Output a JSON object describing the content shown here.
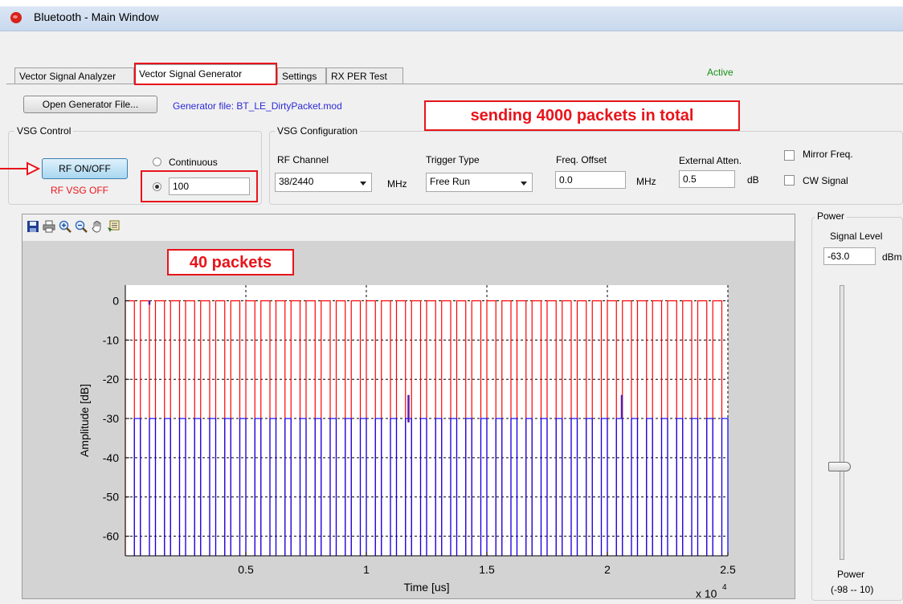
{
  "window": {
    "title": "Bluetooth - Main Window"
  },
  "tabs": [
    {
      "label": "Vector Signal Analyzer"
    },
    {
      "label": "Vector Signal Generator"
    },
    {
      "label": "Settings"
    },
    {
      "label": "RX PER Test"
    }
  ],
  "status": "Active",
  "toolbar": {
    "open_generator_label": "Open Generator File...",
    "generator_file": "Generator file: BT_LE_DirtyPacket.mod"
  },
  "annotations": {
    "top": "sending 4000 packets in total",
    "plot": "40 packets"
  },
  "vsg_control": {
    "group_label": "VSG Control",
    "rf_button_label": "RF ON/OFF",
    "rf_status": "RF VSG OFF",
    "continuous_label": "Continuous",
    "count_value": "100",
    "mode": "count"
  },
  "vsg_config": {
    "group_label": "VSG Configuration",
    "rf_channel_label": "RF Channel",
    "rf_channel_value": "38/2440",
    "rf_channel_unit": "MHz",
    "trigger_type_label": "Trigger Type",
    "trigger_type_value": "Free Run",
    "freq_offset_label": "Freq. Offset",
    "freq_offset_value": "0.0",
    "freq_offset_unit": "MHz",
    "external_atten_label": "External Atten.",
    "external_atten_value": "0.5",
    "external_atten_unit": "dB",
    "mirror_freq_label": "Mirror Freq.",
    "mirror_freq_checked": false,
    "cw_signal_label": "CW Signal",
    "cw_signal_checked": false
  },
  "power": {
    "group_label": "Power",
    "signal_level_label": "Signal Level",
    "signal_level_value": "-63.0",
    "signal_level_unit": "dBm",
    "slider_label": "Power",
    "slider_range": "(-98 -- 10)",
    "slider_value_dbm": -63
  },
  "plot_toolbar_icons": [
    "save-icon",
    "print-icon",
    "zoom-in-icon",
    "zoom-out-icon",
    "pan-hand-icon",
    "data-cursor-icon"
  ],
  "colors": {
    "series_high": "#ff0000",
    "series_low": "#0000ff",
    "annotation": "#e8141b",
    "active": "#169216",
    "link": "#2d2ad8"
  },
  "chart_data": {
    "type": "line",
    "xlabel": "Time [us]",
    "ylabel": "Amplitude [dB]",
    "x_multiplier_label": "x 10",
    "x_multiplier_exponent": "4",
    "xlim": [
      0,
      25000
    ],
    "ylim": [
      -65,
      4
    ],
    "x_ticks": [
      5000,
      10000,
      15000,
      20000,
      25000
    ],
    "x_tick_labels": [
      "0.5",
      "1",
      "1.5",
      "2",
      "2.5"
    ],
    "y_ticks": [
      0,
      -10,
      -20,
      -30,
      -40,
      -50,
      -60
    ],
    "y_tick_labels": [
      "0",
      "-10",
      "-20",
      "-30",
      "-40",
      "-50",
      "-60"
    ],
    "grid": "dashed x and y",
    "series": [
      {
        "color": "#ff0000",
        "level_high_db": 0,
        "level_low_db": -65,
        "start_x": 0,
        "period_x": 625,
        "pulse_x": 375,
        "count": 40
      },
      {
        "color": "#0000ff",
        "level_high_db": -30,
        "level_low_db": -65,
        "start_x": 375,
        "period_x": 625,
        "pulse_x": 250,
        "count": 40
      }
    ],
    "markers": [
      {
        "x": 1000,
        "y_top": 0,
        "y_bottom": -1
      },
      {
        "x": 11750,
        "y_top": -24,
        "y_bottom": -31
      },
      {
        "x": 20600,
        "y_top": -24,
        "y_bottom": -30
      }
    ]
  }
}
